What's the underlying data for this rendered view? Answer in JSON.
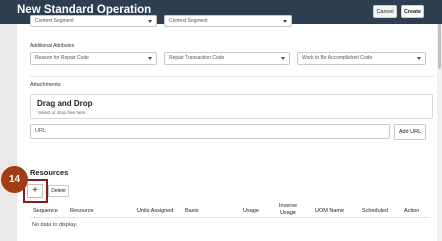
{
  "header": {
    "title": "New Standard Operation",
    "cancel_label": "Cancel",
    "create_label": "Create"
  },
  "top_row": {
    "field1_value": "Context Segment",
    "field2_value": "Context Segment"
  },
  "additional_attributes": {
    "label": "Additional Attributes",
    "reason_placeholder": "Reason for Repair Code",
    "repair_placeholder": "Repair Transaction Code",
    "work_placeholder": "Work to Be Accomplished Code"
  },
  "attachments": {
    "title": "Attachments",
    "drop_title": "Drag and Drop",
    "drop_sub": "Select or drop files here.",
    "url_placeholder": "URL",
    "add_url_label": "Add URL"
  },
  "resources": {
    "title": "Resources",
    "add_label": "+",
    "delete_label": "Delete",
    "step_badge": "14",
    "columns": {
      "sequence": "Sequence",
      "resource": "Resource",
      "units": "Units Assigned",
      "basis": "Basis",
      "usage": "Usage",
      "inverse_line1": "Inverse",
      "inverse_line2": "Usage",
      "uom": "UOM Name",
      "scheduled": "Scheduled",
      "action": "Action"
    },
    "no_data": "No data to display."
  }
}
